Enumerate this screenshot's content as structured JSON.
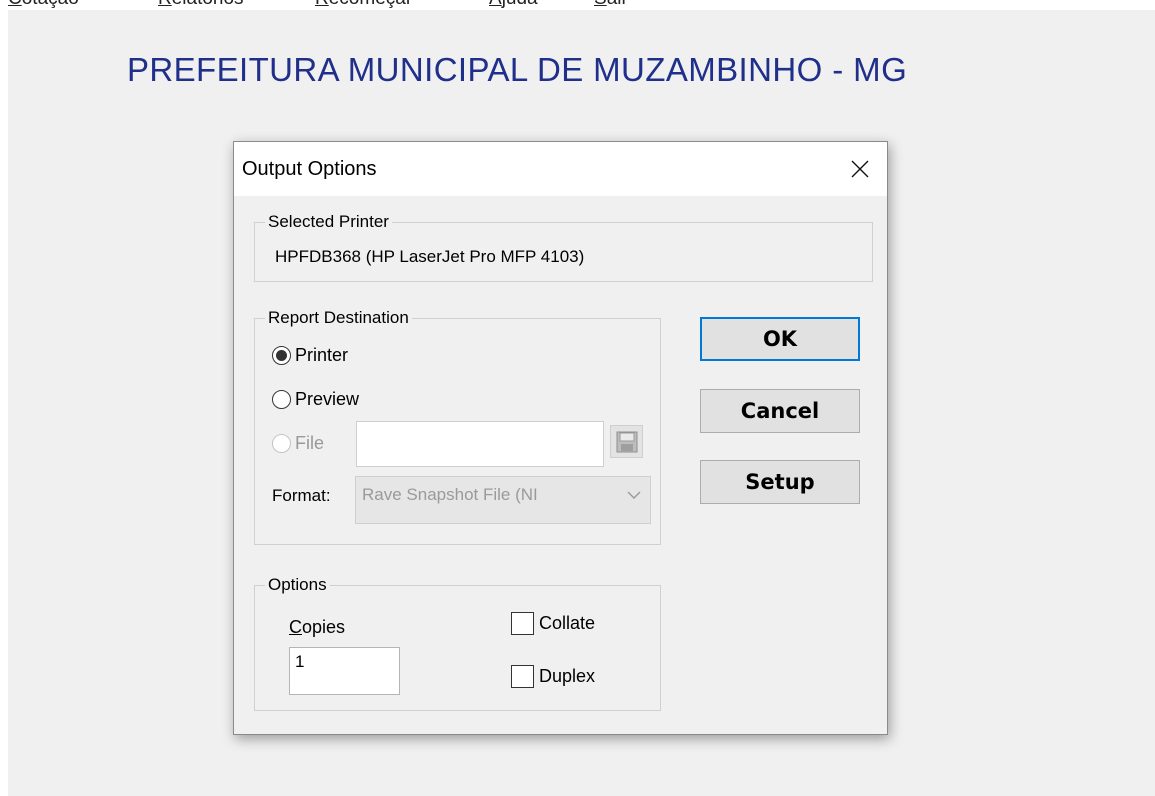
{
  "menubar": {
    "items": [
      "Cotação",
      "Relatórios",
      "Recomeçar",
      "Ajuda",
      "Sair"
    ]
  },
  "app": {
    "title": "PREFEITURA MUNICIPAL DE MUZAMBINHO - MG"
  },
  "dialog": {
    "title": "Output Options",
    "close_icon": "close-icon",
    "selected_printer": {
      "label": "Selected Printer",
      "value": "HPFDB368 (HP LaserJet Pro MFP 4103)"
    },
    "report_destination": {
      "label": "Report Destination",
      "options": [
        {
          "label": "Printer",
          "selected": true,
          "enabled": true
        },
        {
          "label": "Preview",
          "selected": false,
          "enabled": true
        },
        {
          "label": "File",
          "selected": false,
          "enabled": false
        }
      ],
      "file_value": "",
      "file_button_icon": "save-disk-icon",
      "format_label": "Format:",
      "format_value": "Rave Snapshot File (NI",
      "format_chevron_icon": "chevron-down-icon"
    },
    "options": {
      "label": "Options",
      "copies_label": "Copies",
      "copies_value": "1",
      "collate_label": "Collate",
      "collate_checked": false,
      "duplex_label": "Duplex",
      "duplex_checked": false
    },
    "buttons": {
      "ok": "OK",
      "cancel": "Cancel",
      "setup": "Setup"
    }
  },
  "colors": {
    "app_title": "#1f2f8a",
    "default_button_border": "#0078d7",
    "dialog_background": "#f0f0f0"
  }
}
